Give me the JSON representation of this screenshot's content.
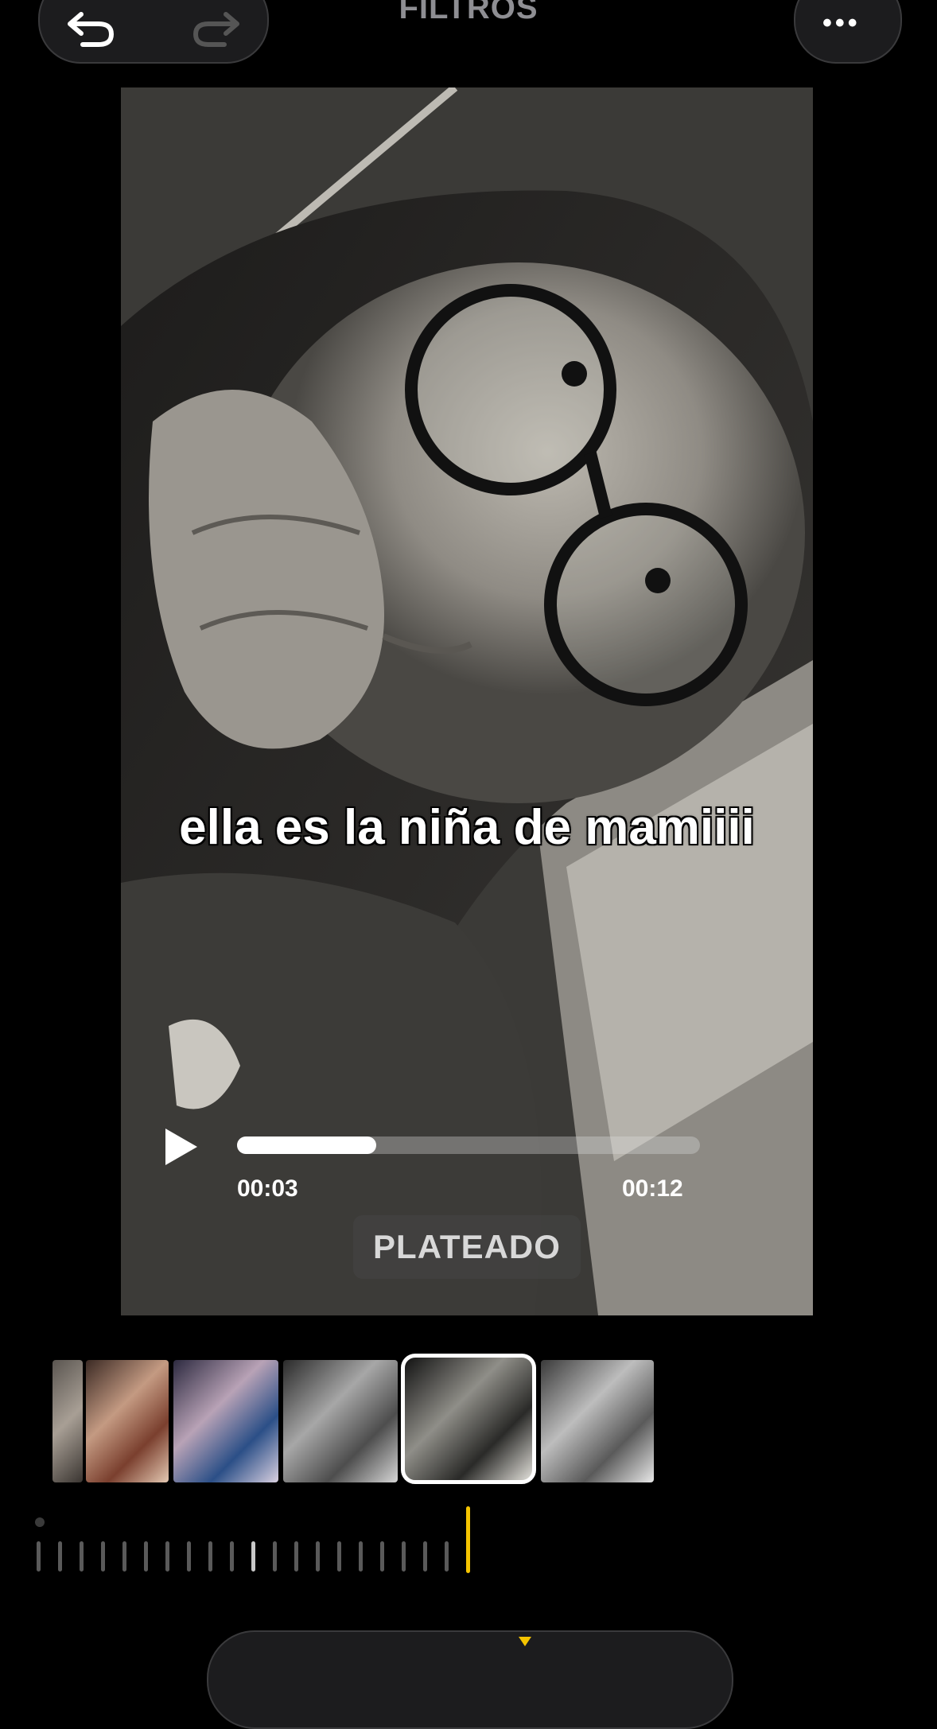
{
  "header": {
    "title": "FILTROS",
    "undo_icon": "undo-icon",
    "redo_icon": "redo-icon",
    "more_icon": "more-icon",
    "more_label": "•••"
  },
  "preview": {
    "caption": "ella es la niña de mamiiii",
    "player": {
      "play_icon": "play-icon",
      "current_time": "00:03",
      "total_time": "00:12",
      "progress": 0.3
    },
    "filter_name": "PLATEADO"
  },
  "filters": {
    "selected_index": 4,
    "items": [
      "filter-partial",
      "filter-warm",
      "filter-cool",
      "filter-mono",
      "filter-plateado",
      "filter-noir"
    ]
  },
  "scrubber": {
    "accent": "#f5c400"
  },
  "toolbar": {
    "indicator_color": "#f5c400"
  }
}
